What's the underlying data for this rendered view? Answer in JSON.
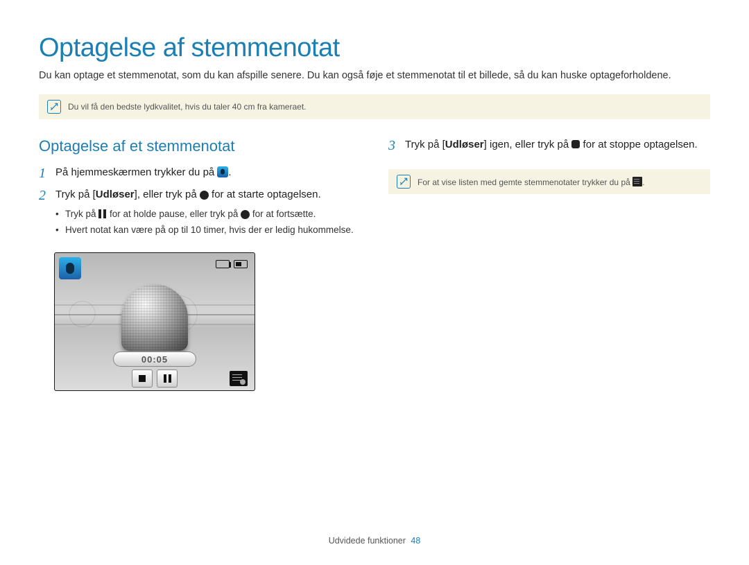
{
  "title": "Optagelse af stemmenotat",
  "intro": "Du kan optage et stemmenotat, som du kan afspille senere. Du kan også føje et stemmenotat til et billede, så du kan huske optageforholdene.",
  "note1": "Du vil få den bedste lydkvalitet, hvis du taler 40 cm fra kameraet.",
  "left": {
    "section_title": "Optagelse af et stemmenotat",
    "step1": {
      "num": "1",
      "pre": "På hjemmeskærmen trykker du på ",
      "post": "."
    },
    "step2": {
      "num": "2",
      "pre": "Tryk på [",
      "bold": "Udløser",
      "mid": "], eller tryk på ",
      "post": " for at starte optagelsen."
    },
    "bullets": {
      "b1_pre": "Tryk på ",
      "b1_mid": " for at holde pause, eller tryk på ",
      "b1_post": " for at fortsætte.",
      "b2": "Hvert notat kan være på op til 10 timer, hvis der er ledig hukommelse."
    },
    "screen": {
      "timer": "00:05"
    }
  },
  "right": {
    "step3": {
      "num": "3",
      "pre": "Tryk på [",
      "bold": "Udløser",
      "mid": "] igen, eller tryk på ",
      "post": " for at stoppe optagelsen."
    },
    "note2_pre": "For at vise listen med gemte stemmenotater trykker du på ",
    "note2_post": "."
  },
  "footer": {
    "section": "Udvidede funktioner",
    "page": "48"
  }
}
